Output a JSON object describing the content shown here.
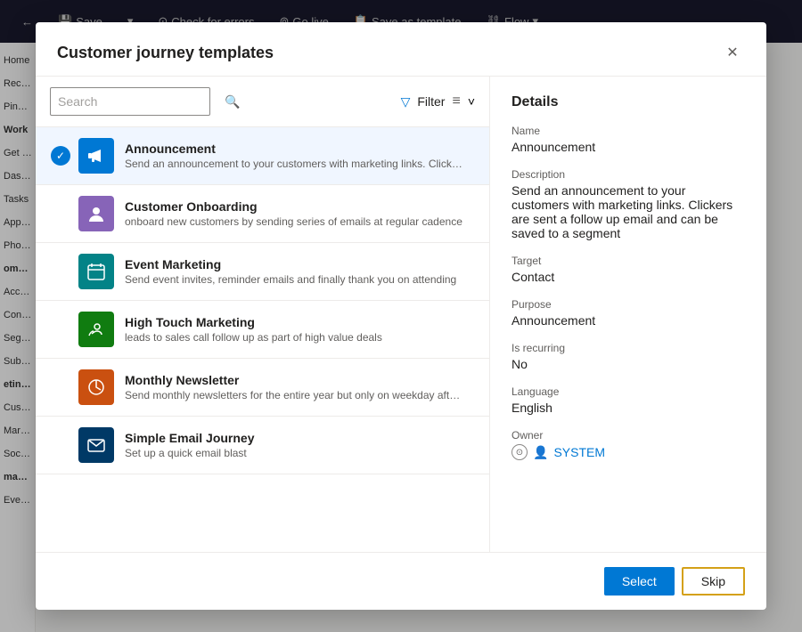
{
  "app": {
    "topbar": {
      "back_icon": "←",
      "save_label": "Save",
      "dropdown_icon": "▾",
      "check_label": "Check for errors",
      "golive_label": "Go live",
      "template_label": "Save as template",
      "flow_label": "Flow",
      "flow_icon": "⛓"
    }
  },
  "sidebar": {
    "items": [
      {
        "label": "Home"
      },
      {
        "label": "Recent"
      },
      {
        "label": "Pinned"
      },
      {
        "label": "Work"
      },
      {
        "label": "Get start"
      },
      {
        "label": "Dashboa"
      },
      {
        "label": "Tasks"
      },
      {
        "label": "Appoint"
      },
      {
        "label": "Phone C"
      },
      {
        "label": "omers"
      },
      {
        "label": "Account"
      },
      {
        "label": "Contact"
      },
      {
        "label": "Segment"
      },
      {
        "label": "Subscri"
      },
      {
        "label": "eting ex"
      },
      {
        "label": "Custome"
      },
      {
        "label": "Marketi"
      },
      {
        "label": "Social p"
      },
      {
        "label": "manag"
      },
      {
        "label": "Events"
      }
    ]
  },
  "modal": {
    "title": "Customer journey templates",
    "close_icon": "✕",
    "search": {
      "placeholder": "Search",
      "icon": "🔍"
    },
    "filter": {
      "label": "Filter",
      "icon": "▽",
      "sort_icon": "≡",
      "dropdown_icon": "˅"
    },
    "templates": [
      {
        "id": "announcement",
        "name": "Announcement",
        "description": "Send an announcement to your customers with marketing links. Clickers are sent a...",
        "icon_char": "📢",
        "icon_class": "icon-blue",
        "selected": true
      },
      {
        "id": "customer-onboarding",
        "name": "Customer Onboarding",
        "description": "onboard new customers by sending series of emails at regular cadence",
        "icon_char": "👤",
        "icon_class": "icon-purple",
        "selected": false
      },
      {
        "id": "event-marketing",
        "name": "Event Marketing",
        "description": "Send event invites, reminder emails and finally thank you on attending",
        "icon_char": "📅",
        "icon_class": "icon-teal",
        "selected": false
      },
      {
        "id": "high-touch",
        "name": "High Touch Marketing",
        "description": "leads to sales call follow up as part of high value deals",
        "icon_char": "📞",
        "icon_class": "icon-green",
        "selected": false
      },
      {
        "id": "monthly-newsletter",
        "name": "Monthly Newsletter",
        "description": "Send monthly newsletters for the entire year but only on weekday afternoons",
        "icon_char": "🔄",
        "icon_class": "icon-orange",
        "selected": false
      },
      {
        "id": "simple-email",
        "name": "Simple Email Journey",
        "description": "Set up a quick email blast",
        "icon_char": "✉",
        "icon_class": "icon-navy",
        "selected": false
      }
    ],
    "details": {
      "heading": "Details",
      "name_label": "Name",
      "name_value": "Announcement",
      "description_label": "Description",
      "description_value": "Send an announcement to your customers with marketing links. Clickers are sent a follow up email and can be saved to a segment",
      "target_label": "Target",
      "target_value": "Contact",
      "purpose_label": "Purpose",
      "purpose_value": "Announcement",
      "recurring_label": "Is recurring",
      "recurring_value": "No",
      "language_label": "Language",
      "language_value": "English",
      "owner_label": "Owner",
      "owner_value": "SYSTEM",
      "owner_icon": "🔵"
    },
    "footer": {
      "select_label": "Select",
      "skip_label": "Skip"
    }
  }
}
